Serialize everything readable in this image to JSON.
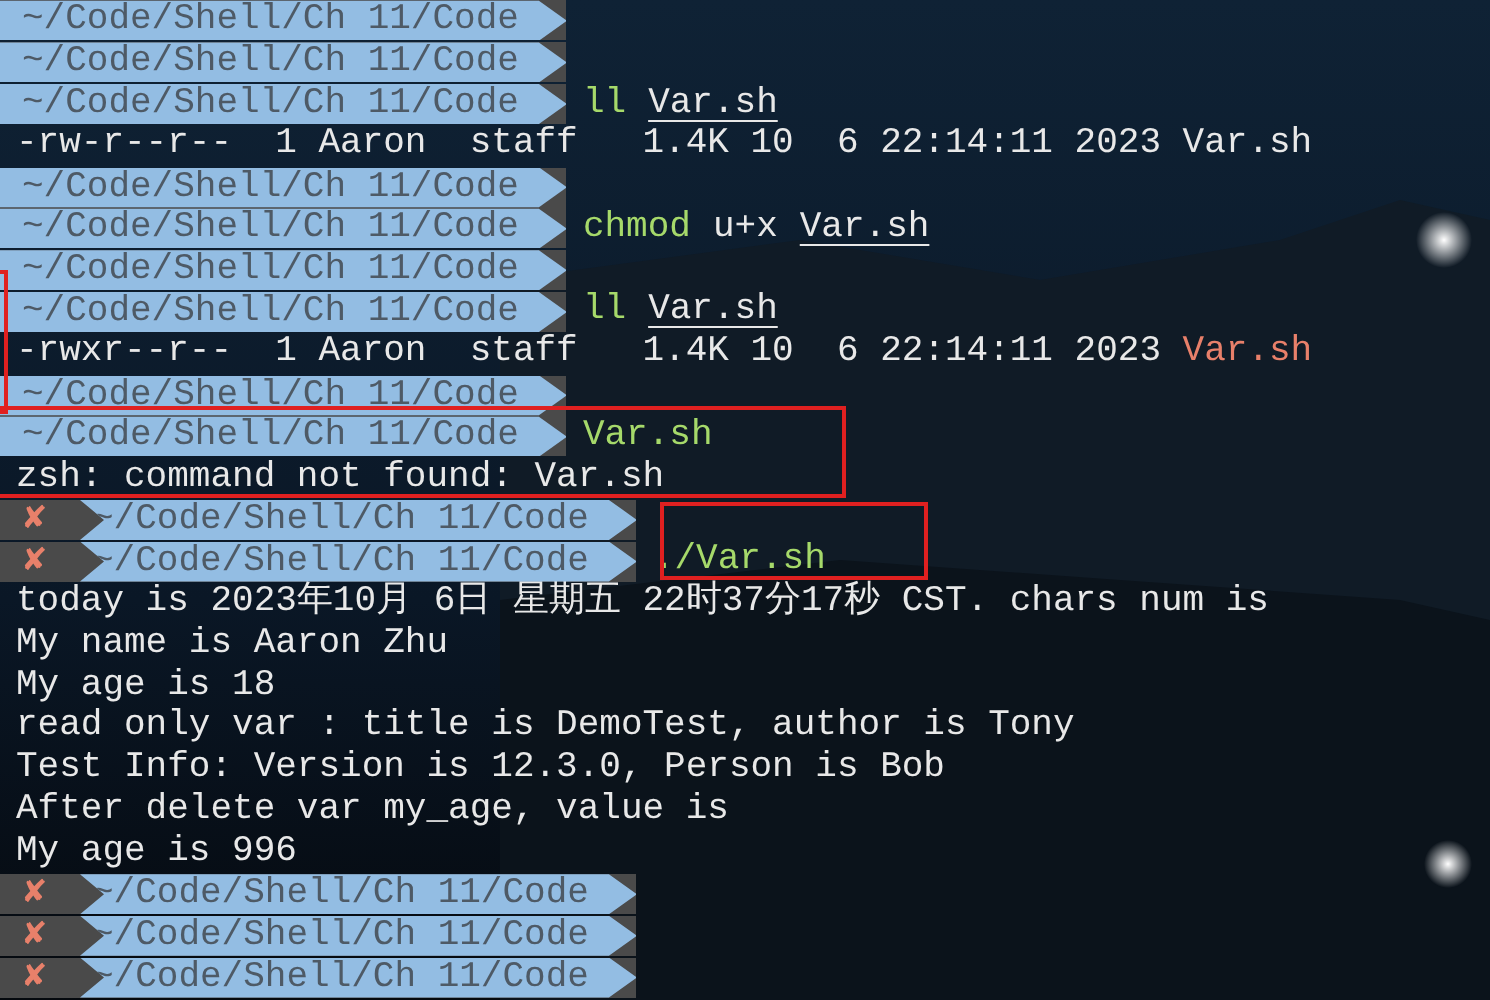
{
  "lines": [
    {
      "kind": "prompt",
      "error": false,
      "path": "~/Code/Shell/Ch 11/Code"
    },
    {
      "kind": "prompt",
      "error": false,
      "path": "~/Code/Shell/Ch 11/Code"
    },
    {
      "kind": "prompt",
      "error": false,
      "path": "~/Code/Shell/Ch 11/Code",
      "command": [
        {
          "kind": "command",
          "text": "ll"
        },
        {
          "kind": "file",
          "text": "Var.sh"
        }
      ]
    },
    {
      "kind": "output",
      "parts": [
        {
          "kind": "plain",
          "text": "-rw-r--r--  1 Aaron  staff   1.4K 10  6 22:14:11 2023 Var.sh"
        }
      ]
    },
    {
      "kind": "prompt",
      "error": false,
      "path": "~/Code/Shell/Ch 11/Code"
    },
    {
      "kind": "prompt",
      "error": false,
      "path": "~/Code/Shell/Ch 11/Code",
      "command": [
        {
          "kind": "command",
          "text": "chmod"
        },
        {
          "kind": "plain",
          "text": "u+x"
        },
        {
          "kind": "file",
          "text": "Var.sh"
        }
      ]
    },
    {
      "kind": "prompt",
      "error": false,
      "path": "~/Code/Shell/Ch 11/Code"
    },
    {
      "kind": "prompt",
      "error": false,
      "path": "~/Code/Shell/Ch 11/Code",
      "command": [
        {
          "kind": "command",
          "text": "ll"
        },
        {
          "kind": "file",
          "text": "Var.sh"
        }
      ]
    },
    {
      "kind": "output",
      "parts": [
        {
          "kind": "plain",
          "text": "-rwxr--r--  1 Aaron  staff   1.4K 10  6 22:14:11 2023 "
        },
        {
          "kind": "executable",
          "text": "Var.sh"
        }
      ]
    },
    {
      "kind": "prompt",
      "error": false,
      "path": "~/Code/Shell/Ch 11/Code"
    },
    {
      "kind": "prompt",
      "error": false,
      "path": "~/Code/Shell/Ch 11/Code",
      "command": [
        {
          "kind": "command",
          "text": "Var.sh"
        }
      ]
    },
    {
      "kind": "output",
      "parts": [
        {
          "kind": "plain",
          "text": "zsh: command not found: Var.sh"
        }
      ]
    },
    {
      "kind": "prompt",
      "error": true,
      "mark": "✘",
      "path": "~/Code/Shell/Ch 11/Code"
    },
    {
      "kind": "prompt",
      "error": true,
      "mark": "✘",
      "path": "~/Code/Shell/Ch 11/Code",
      "command": [
        {
          "kind": "command",
          "text": "./Var.sh"
        }
      ]
    },
    {
      "kind": "output",
      "parts": [
        {
          "kind": "plain",
          "text": "today is 2023年10月 6日 星期五 22时37分17秒 CST. chars num is"
        }
      ]
    },
    {
      "kind": "output",
      "parts": [
        {
          "kind": "plain",
          "text": "My name is Aaron Zhu"
        }
      ]
    },
    {
      "kind": "output",
      "parts": [
        {
          "kind": "plain",
          "text": "My age is 18"
        }
      ]
    },
    {
      "kind": "output",
      "parts": [
        {
          "kind": "plain",
          "text": "read only var : title is DemoTest, author is Tony"
        }
      ]
    },
    {
      "kind": "output",
      "parts": [
        {
          "kind": "plain",
          "text": "Test Info: Version is 12.3.0, Person is Bob"
        }
      ]
    },
    {
      "kind": "output",
      "parts": [
        {
          "kind": "plain",
          "text": "After delete var my_age, value is"
        }
      ]
    },
    {
      "kind": "output",
      "parts": [
        {
          "kind": "plain",
          "text": "My age is 996"
        }
      ]
    },
    {
      "kind": "prompt",
      "error": true,
      "mark": "✘",
      "path": "~/Code/Shell/Ch 11/Code"
    },
    {
      "kind": "prompt",
      "error": true,
      "mark": "✘",
      "path": "~/Code/Shell/Ch 11/Code"
    },
    {
      "kind": "prompt",
      "error": true,
      "mark": "✘",
      "path": "~/Code/Shell/Ch 11/Code"
    }
  ]
}
